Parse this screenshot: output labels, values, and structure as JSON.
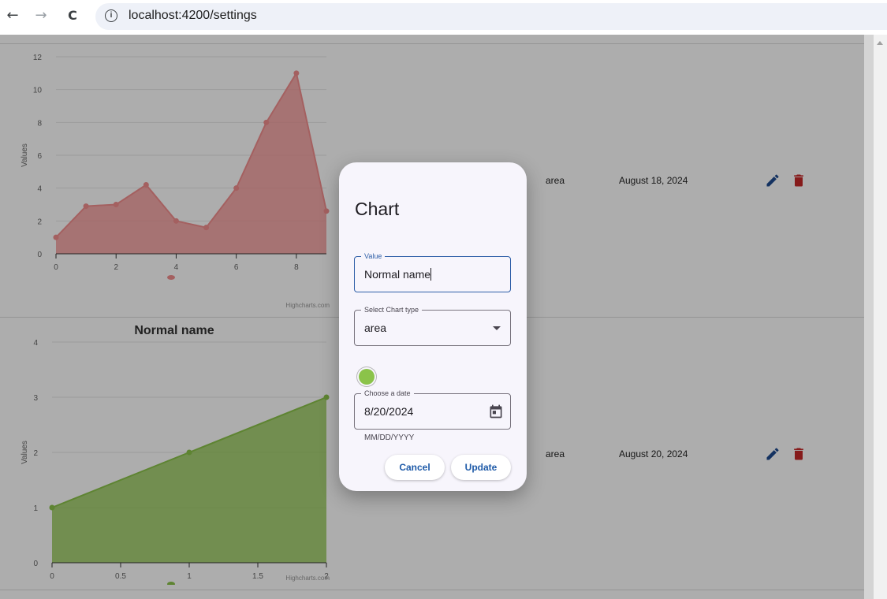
{
  "browser": {
    "back_glyph": "←",
    "forward_glyph": "→",
    "reload_glyph": "C",
    "info_glyph": "i",
    "url": "localhost:4200/settings"
  },
  "rows": [
    {
      "type": "area",
      "date": "August 18, 2024",
      "chart": {
        "title": "",
        "ylabel": "Values",
        "credits": "Highcharts.com",
        "color": "#f28e8e",
        "x_ticks": [
          "0",
          "2",
          "4",
          "6",
          "8"
        ],
        "y_ticks": [
          "0",
          "2",
          "4",
          "6",
          "8",
          "10",
          "12"
        ]
      }
    },
    {
      "type": "area",
      "date": "August 20, 2024",
      "chart": {
        "title": "Normal name",
        "ylabel": "Values",
        "credits": "Highcharts.com",
        "color": "#8bc34a",
        "x_ticks": [
          "0",
          "0.5",
          "1",
          "1.5",
          "2"
        ],
        "y_ticks": [
          "0",
          "1",
          "2",
          "3",
          "4"
        ]
      }
    }
  ],
  "chart_data": [
    {
      "type": "area",
      "title": "",
      "ylabel": "Values",
      "x": [
        0,
        1,
        2,
        3,
        4,
        5,
        6,
        7,
        8,
        9
      ],
      "values": [
        1,
        2.9,
        3,
        4.2,
        2,
        1.6,
        4,
        8,
        11,
        2.6
      ],
      "xlim": [
        0,
        9
      ],
      "ylim": [
        0,
        12
      ],
      "color": "#f28e8e"
    },
    {
      "type": "area",
      "title": "Normal name",
      "ylabel": "Values",
      "x": [
        0,
        1,
        2
      ],
      "values": [
        1,
        2,
        3
      ],
      "xlim": [
        0,
        2
      ],
      "ylim": [
        0,
        4
      ],
      "color": "#8bc34a"
    }
  ],
  "dialog": {
    "title": "Chart",
    "value_label": "Value",
    "value_text": "Normal name",
    "chart_type_label": "Select Chart type",
    "chart_type_value": "area",
    "color": "#8bc34a",
    "date_label": "Choose a date",
    "date_value": "8/20/2024",
    "date_hint": "MM/DD/YYYY",
    "cancel_label": "Cancel",
    "update_label": "Update"
  },
  "colors": {
    "edit_icon": "#1e4b8f",
    "delete_icon": "#c62828",
    "accent": "#2f5fa8"
  }
}
